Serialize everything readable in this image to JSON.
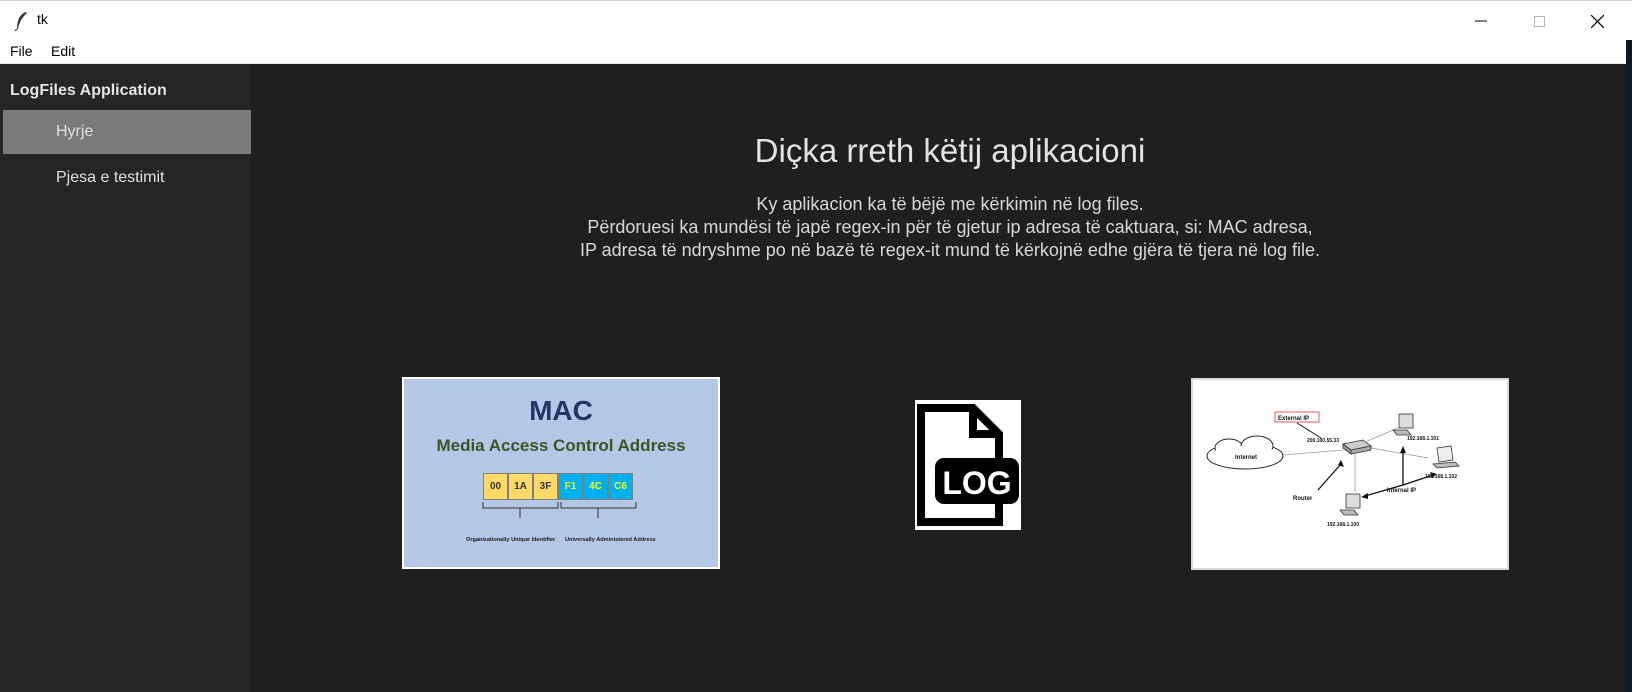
{
  "window": {
    "title": "tk",
    "minimize_icon": "minimize-icon",
    "maximize_icon": "maximize-icon",
    "close_icon": "close-icon"
  },
  "menu": {
    "items": [
      {
        "label": "File"
      },
      {
        "label": "Edit"
      }
    ]
  },
  "sidebar": {
    "title": "LogFiles Application",
    "items": [
      {
        "label": "Hyrje",
        "active": true
      },
      {
        "label": "Pjesa e testimit",
        "active": false
      }
    ]
  },
  "main": {
    "title": "Diçka rreth këtij aplikacioni",
    "description": [
      "Ky aplikacion ka të bëjë me kërkimin në log files.",
      "Përdoruesi ka mundësi të japë regex-in për të gjetur ip adresa të caktuara, si: MAC adresa,",
      "IP adresa të ndryshme po në bazë të regex-it mund të kërkojnë edhe gjëra të tjera në log file."
    ]
  },
  "images": {
    "mac": {
      "title": "MAC",
      "subtitle": "Media Access Control Address",
      "octets": [
        "00",
        "1A",
        "3F",
        "F1",
        "4C",
        "C6"
      ],
      "label_oui": "Organizationally Unique Identifier",
      "label_uaa": "Universally Administered Address"
    },
    "log": {
      "icon": "log-file-icon",
      "text": "LOG"
    },
    "network": {
      "external_ip_label": "External IP",
      "external_ip": "200.100.55.33",
      "internet_label": "Internet",
      "router_label": "Router",
      "internal_ip_label": "Internal IP",
      "host_ips": [
        "192.168.1.101",
        "192.168.1.102",
        "192.168.1.100"
      ]
    }
  }
}
